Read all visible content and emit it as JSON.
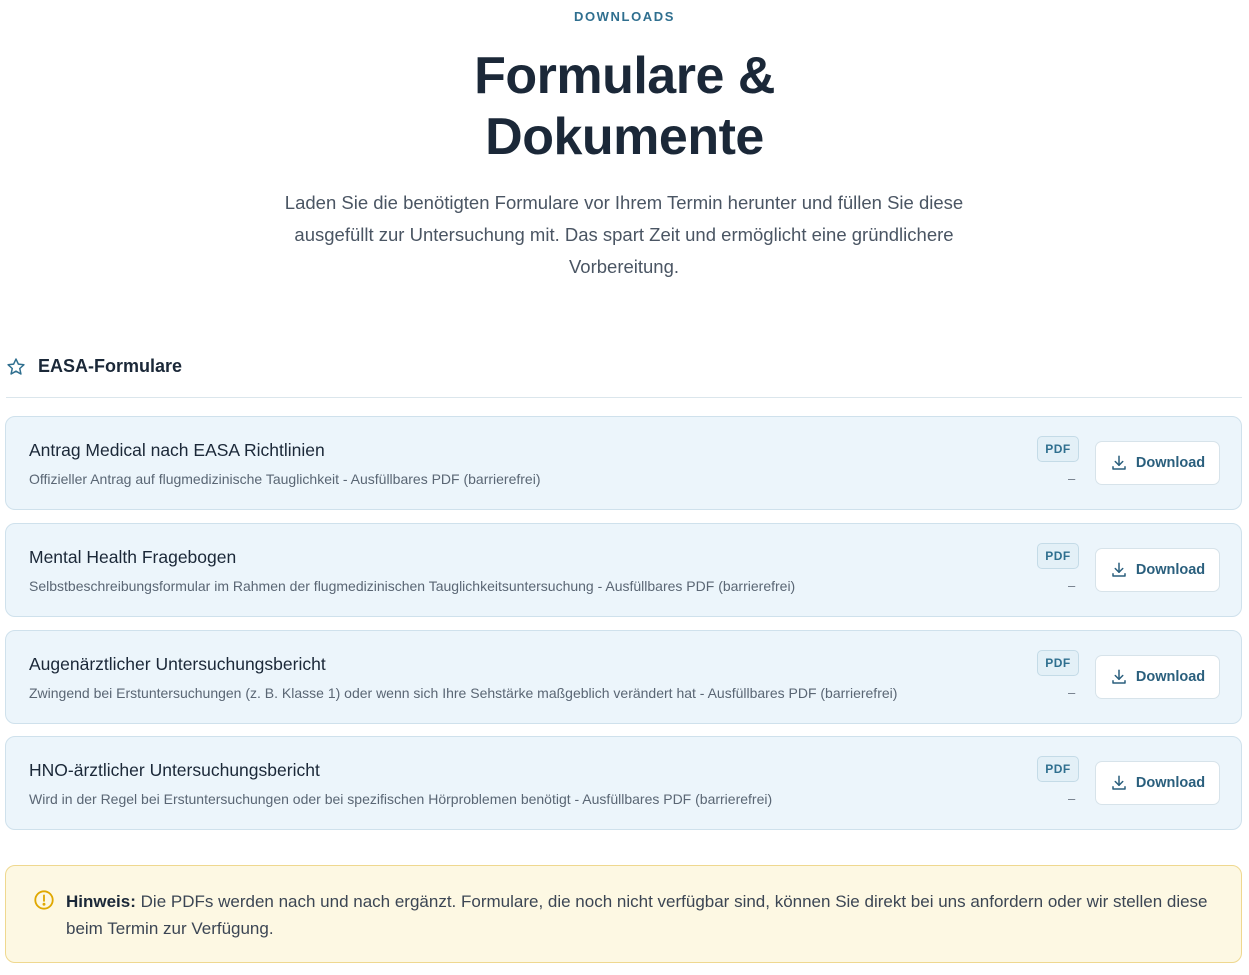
{
  "header": {
    "eyebrow": "DOWNLOADS",
    "title_line1": "Formulare &",
    "title_line2": "Dokumente",
    "intro": "Laden Sie die benötigten Formulare vor Ihrem Termin herunter und füllen Sie diese ausgefüllt zur Untersuchung mit. Das spart Zeit und ermöglicht eine gründlichere Vorbereitung."
  },
  "section": {
    "icon": "star-icon",
    "title": "EASA-Formulare"
  },
  "documents": [
    {
      "title": "Antrag Medical nach EASA Richtlinien",
      "description": "Offizieller Antrag auf flugmedizinische Tauglichkeit - Ausfüllbares PDF (barrierefrei)",
      "badge": "PDF",
      "size": "–",
      "button_label": "Download"
    },
    {
      "title": "Mental Health Fragebogen",
      "description": "Selbstbeschreibungsformular im Rahmen der flugmedizinischen Tauglichkeitsuntersuchung - Ausfüllbares PDF (barrierefrei)",
      "badge": "PDF",
      "size": "–",
      "button_label": "Download"
    },
    {
      "title": "Augenärztlicher Untersuchungsbericht",
      "description": "Zwingend bei Erstuntersuchungen (z. B. Klasse 1) oder wenn sich Ihre Sehstärke maßgeblich verändert hat - Ausfüllbares PDF (barrierefrei)",
      "badge": "PDF",
      "size": "–",
      "button_label": "Download"
    },
    {
      "title": "HNO-ärztlicher Untersuchungsbericht",
      "description": "Wird in der Regel bei Erstuntersuchungen oder bei spezifischen Hörproblemen benötigt - Ausfüllbares PDF (barrierefrei)",
      "badge": "PDF",
      "size": "–",
      "button_label": "Download"
    }
  ],
  "notice": {
    "icon": "warning-circle-icon",
    "label": "Hinweis:",
    "text": "Die PDFs werden nach und nach ergänzt. Formulare, die noch nicht verfügbar sind, können Sie direkt bei uns anfordern oder wir stellen diese beim Termin zur Verfügung."
  },
  "colors": {
    "accent": "#2f6f8f",
    "card_bg": "#ecf5fb",
    "notice_bg": "#fdf8e3",
    "notice_border": "#efd88f",
    "warning": "#e0a800"
  }
}
